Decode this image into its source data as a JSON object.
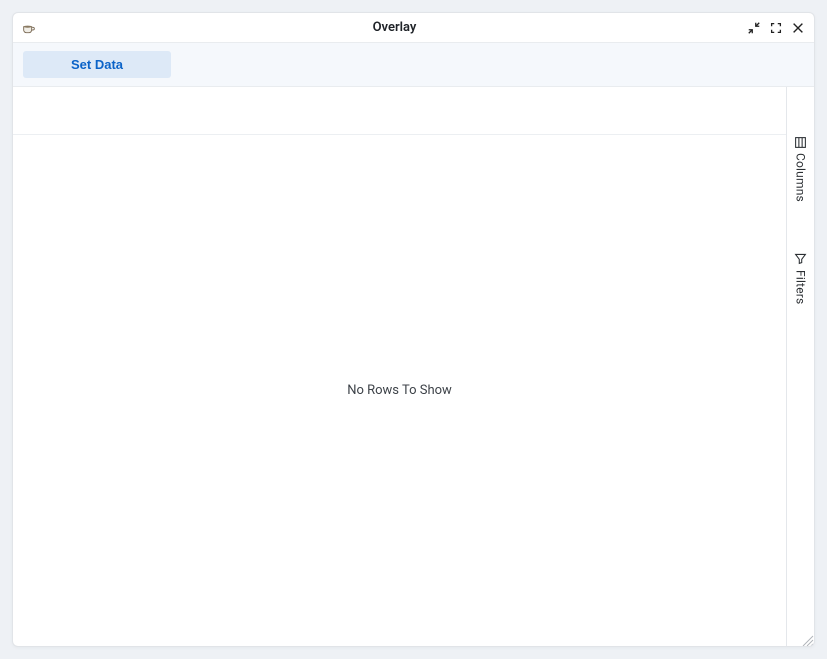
{
  "window": {
    "title": "Overlay"
  },
  "toolbar": {
    "set_data_label": "Set Data"
  },
  "grid": {
    "empty_message": "No Rows To Show"
  },
  "side_panel": {
    "columns_label": "Columns",
    "filters_label": "Filters"
  }
}
